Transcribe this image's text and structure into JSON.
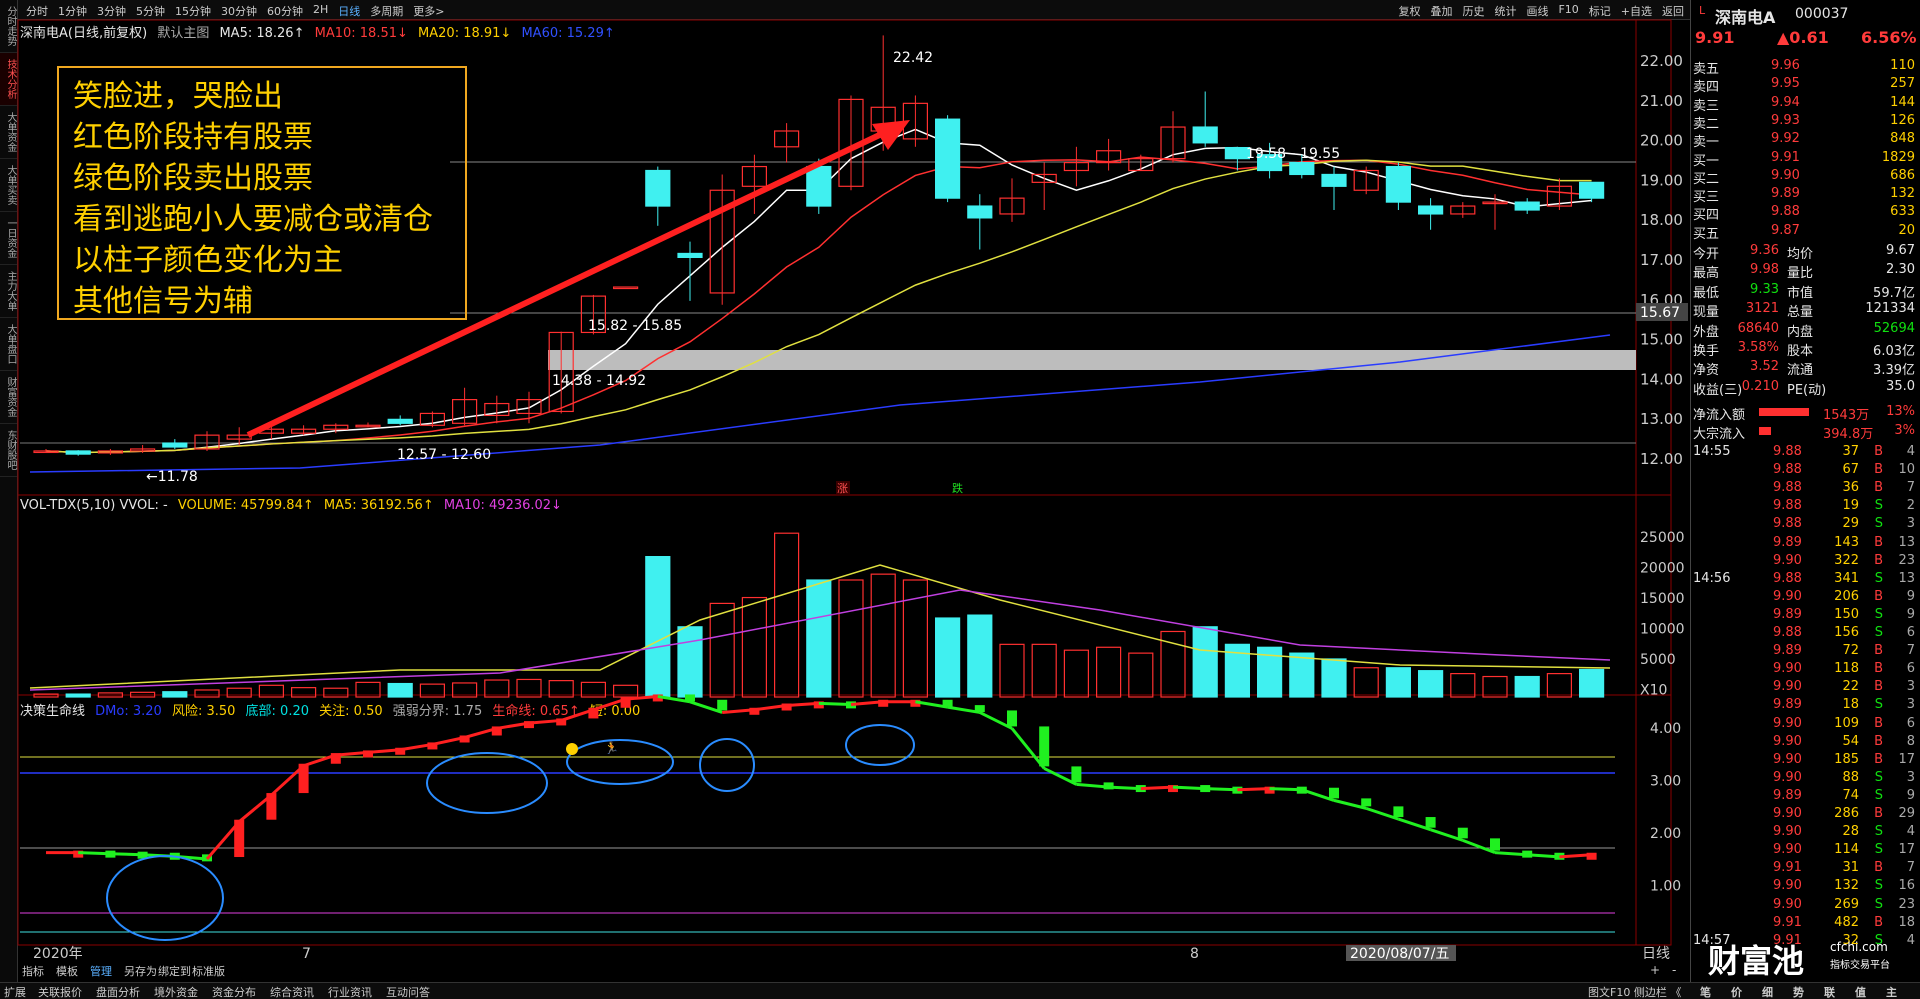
{
  "side_tabs": [
    "分时走势",
    "技术分析",
    "大单资金",
    "大单买卖",
    "一日资金",
    "主力大单",
    "大单盘口",
    "财富资金",
    "东财股吧"
  ],
  "periods": [
    "分时",
    "1分钟",
    "3分钟",
    "5分钟",
    "15分钟",
    "30分钟",
    "60分钟",
    "2H",
    "日线",
    "多周期",
    "更多>"
  ],
  "active_period": "日线",
  "tools": [
    "复权",
    "叠加",
    "历史",
    "统计",
    "画线",
    "F10",
    "标记",
    "+自选",
    "返回"
  ],
  "header": {
    "title": "深南电A(日线,前复权)",
    "main": "默认主图",
    "ma5": "MA5: 18.26↑",
    "ma10": "MA10: 18.51↓",
    "ma20": "MA20: 18.91↓",
    "ma60": "MA60: 15.29↑"
  },
  "vol_header": {
    "name": "VOL-TDX(5,10) VVOL: -",
    "volume": "VOLUME: 45799.84↑",
    "ma5": "MA5: 36192.56↑",
    "ma10": "MA10: 49236.02↓"
  },
  "ind_header": {
    "name": "决策生命线",
    "dmo": "DMo: 3.20",
    "risk": "风险: 3.50",
    "bottom": "底部: 0.20",
    "focus": "关注: 0.50",
    "divide": "强弱分界: 1.75",
    "life": "生命线: 0.65↑",
    "short": "短: 0.00"
  },
  "annotation": [
    "笑脸进，哭脸出",
    "红色阶段持有股票",
    "绿色阶段卖出股票",
    "看到逃跑小人要减仓或清仓",
    "以柱子颜色变化为主",
    "其他信号为辅"
  ],
  "price_labels": {
    "high": "22.42",
    "low": "←11.78",
    "r1": "19.58 - 19.55",
    "r2": "15.82 - 15.85",
    "r3": "14.38 - 14.92",
    "r4": "12.57 - 12.60",
    "current": "15.67",
    "up": "涨",
    "down": "跌"
  },
  "price_axis": [
    "22.00",
    "21.00",
    "20.00",
    "19.00",
    "18.00",
    "17.00",
    "16.00",
    "15.00",
    "14.00",
    "13.00",
    "12.00"
  ],
  "vol_axis": [
    "25000",
    "20000",
    "15000",
    "10000",
    "5000",
    "X10"
  ],
  "ind_axis": [
    "4.00",
    "3.00",
    "2.00",
    "1.00"
  ],
  "date_axis": {
    "year": "2020年",
    "m7": "7",
    "m8": "8",
    "cursor": "2020/08/07/五",
    "period": "日线",
    "plus": "+",
    "minus": "-"
  },
  "footer": [
    "指标",
    "模板",
    "管理",
    "另存为",
    "绑定到",
    "标准版"
  ],
  "bottom_tabs": [
    "扩展",
    "关联报价",
    "盘面分析",
    "境外资金",
    "资金分布",
    "综合资讯",
    "行业资讯",
    "互动问答"
  ],
  "bottom_right": "图文F10 侧边栏 《",
  "bottom_icons": [
    "笔",
    "价",
    "细",
    "势",
    "联",
    "值",
    "主"
  ],
  "quote": {
    "name": "深南电A",
    "code": "000037",
    "price": "9.91",
    "change": "▲0.61",
    "pct": "6.56%"
  },
  "asks": [
    [
      "卖五",
      "9.96",
      "110"
    ],
    [
      "卖四",
      "9.95",
      "257"
    ],
    [
      "卖三",
      "9.94",
      "144"
    ],
    [
      "卖二",
      "9.93",
      "126"
    ],
    [
      "卖一",
      "9.92",
      "848"
    ]
  ],
  "bids": [
    [
      "买一",
      "9.91",
      "1829"
    ],
    [
      "买二",
      "9.90",
      "686"
    ],
    [
      "买三",
      "9.89",
      "132"
    ],
    [
      "买四",
      "9.88",
      "633"
    ],
    [
      "买五",
      "9.87",
      "20"
    ]
  ],
  "stats": [
    [
      "今开",
      "9.36",
      "均价",
      "9.67"
    ],
    [
      "最高",
      "9.98",
      "量比",
      "2.30"
    ],
    [
      "最低",
      "9.33",
      "市值",
      "59.7亿"
    ],
    [
      "现量",
      "3121",
      "总量",
      "121334"
    ],
    [
      "外盘",
      "68640",
      "内盘",
      "52694"
    ],
    [
      "换手",
      "3.58%",
      "股本",
      "6.03亿"
    ],
    [
      "净资",
      "3.52",
      "流通",
      "3.39亿"
    ],
    [
      "收益(三)",
      "0.210",
      "PE(动)",
      "35.0"
    ]
  ],
  "flow": [
    [
      "净流入额",
      "1543万",
      "13%"
    ],
    [
      "大宗流入",
      "394.8万",
      "3%"
    ]
  ],
  "ticks": [
    [
      "14:55",
      "9.88",
      "37",
      "B",
      "4"
    ],
    [
      "",
      "9.88",
      "67",
      "B",
      "10"
    ],
    [
      "",
      "9.88",
      "36",
      "B",
      "7"
    ],
    [
      "",
      "9.88",
      "19",
      "S",
      "2"
    ],
    [
      "",
      "9.88",
      "29",
      "S",
      "3"
    ],
    [
      "",
      "9.89",
      "143",
      "B",
      "13"
    ],
    [
      "",
      "9.90",
      "322",
      "B",
      "23"
    ],
    [
      "14:56",
      "9.88",
      "341",
      "S",
      "13"
    ],
    [
      "",
      "9.90",
      "206",
      "B",
      "9"
    ],
    [
      "",
      "9.89",
      "150",
      "S",
      "9"
    ],
    [
      "",
      "9.88",
      "156",
      "S",
      "6"
    ],
    [
      "",
      "9.89",
      "72",
      "B",
      "7"
    ],
    [
      "",
      "9.90",
      "118",
      "B",
      "6"
    ],
    [
      "",
      "9.90",
      "22",
      "B",
      "3"
    ],
    [
      "",
      "9.89",
      "18",
      "S",
      "3"
    ],
    [
      "",
      "9.90",
      "109",
      "B",
      "6"
    ],
    [
      "",
      "9.90",
      "54",
      "B",
      "8"
    ],
    [
      "",
      "9.90",
      "185",
      "B",
      "17"
    ],
    [
      "",
      "9.90",
      "88",
      "S",
      "3"
    ],
    [
      "",
      "9.89",
      "74",
      "S",
      "9"
    ],
    [
      "",
      "9.90",
      "286",
      "B",
      "29"
    ],
    [
      "",
      "9.90",
      "28",
      "S",
      "4"
    ],
    [
      "",
      "9.90",
      "114",
      "S",
      "17"
    ],
    [
      "",
      "9.91",
      "31",
      "B",
      "7"
    ],
    [
      "",
      "9.90",
      "132",
      "S",
      "16"
    ],
    [
      "",
      "9.90",
      "269",
      "S",
      "23"
    ],
    [
      "",
      "9.91",
      "482",
      "B",
      "18"
    ],
    [
      "14:57",
      "9.91",
      "32",
      "S",
      "4"
    ]
  ],
  "logo": {
    "main": "财富池",
    "site": "cfchi.com",
    "sub": "指标交易平台"
  },
  "chart_data": {
    "type": "candlestick",
    "price_range": [
      11.5,
      22.5
    ],
    "candles": [
      [
        11.9,
        11.95,
        11.85,
        11.9
      ],
      [
        11.9,
        11.92,
        11.78,
        11.82
      ],
      [
        11.85,
        11.95,
        11.8,
        11.9
      ],
      [
        11.9,
        12.05,
        11.85,
        11.95
      ],
      [
        12.1,
        12.2,
        11.95,
        12.0
      ],
      [
        11.95,
        12.4,
        11.9,
        12.3
      ],
      [
        12.2,
        12.5,
        12.05,
        12.3
      ],
      [
        12.35,
        12.6,
        12.2,
        12.45
      ],
      [
        12.35,
        12.55,
        12.3,
        12.45
      ],
      [
        12.45,
        12.6,
        12.35,
        12.55
      ],
      [
        12.55,
        12.62,
        12.5,
        12.55
      ],
      [
        12.7,
        12.8,
        12.55,
        12.6
      ],
      [
        12.55,
        12.9,
        12.5,
        12.85
      ],
      [
        12.6,
        13.5,
        12.55,
        13.2
      ],
      [
        12.8,
        13.3,
        12.6,
        13.1
      ],
      [
        12.85,
        13.4,
        12.6,
        13.2
      ],
      [
        12.9,
        14.92,
        12.85,
        14.9
      ],
      [
        14.9,
        15.85,
        14.85,
        15.82
      ],
      [
        16.05,
        16.05,
        16.05,
        16.05
      ],
      [
        19.0,
        19.1,
        17.6,
        18.1
      ],
      [
        16.9,
        17.2,
        15.7,
        16.8
      ],
      [
        15.9,
        18.9,
        15.6,
        18.5
      ],
      [
        18.6,
        19.4,
        17.9,
        19.1
      ],
      [
        19.6,
        20.2,
        19.2,
        20.0
      ],
      [
        19.1,
        19.3,
        17.9,
        18.1
      ],
      [
        18.6,
        20.9,
        18.5,
        20.8
      ],
      [
        20.0,
        22.42,
        19.5,
        20.6
      ],
      [
        19.8,
        20.9,
        19.6,
        20.7
      ],
      [
        20.3,
        20.4,
        18.2,
        18.3
      ],
      [
        18.1,
        18.4,
        17.0,
        17.8
      ],
      [
        17.9,
        18.8,
        17.7,
        18.3
      ],
      [
        18.7,
        19.2,
        18.0,
        18.9
      ],
      [
        19.0,
        19.6,
        18.6,
        19.2
      ],
      [
        19.2,
        19.8,
        19.0,
        19.5
      ],
      [
        19.0,
        19.4,
        19.0,
        19.3
      ],
      [
        19.3,
        20.5,
        19.2,
        20.1
      ],
      [
        20.1,
        21.0,
        19.6,
        19.7
      ],
      [
        19.58,
        19.6,
        19.0,
        19.3
      ],
      [
        19.4,
        19.7,
        18.8,
        19.0
      ],
      [
        19.2,
        19.4,
        18.8,
        18.9
      ],
      [
        18.9,
        19.1,
        18.0,
        18.6
      ],
      [
        18.5,
        19.1,
        18.4,
        19.0
      ],
      [
        19.1,
        19.2,
        18.0,
        18.2
      ],
      [
        18.1,
        18.3,
        17.5,
        17.9
      ],
      [
        17.9,
        18.2,
        17.8,
        18.1
      ],
      [
        18.2,
        18.4,
        17.5,
        18.2
      ],
      [
        18.2,
        18.3,
        17.9,
        18.0
      ],
      [
        18.1,
        18.8,
        18.0,
        18.6
      ],
      [
        18.7,
        18.7,
        18.2,
        18.3
      ]
    ],
    "volume": [
      500,
      500,
      700,
      800,
      900,
      1200,
      1500,
      2000,
      1600,
      1500,
      2500,
      2300,
      2200,
      2400,
      2900,
      3000,
      2800,
      2500,
      2000,
      24000,
      12000,
      16000,
      17000,
      28000,
      20000,
      20000,
      21000,
      20000,
      13500,
      14000,
      9000,
      9000,
      8000,
      8500,
      7500,
      11200,
      12000,
      9000,
      8500,
      7500,
      6500,
      5000,
      5000,
      4500,
      4000,
      3500,
      3500,
      4000,
      4700
    ],
    "indicator": [
      0.72,
      0.72,
      0.7,
      0.68,
      0.65,
      0.6,
      1.3,
      1.8,
      2.35,
      2.55,
      2.6,
      2.65,
      2.75,
      2.88,
      3.05,
      3.15,
      3.2,
      3.4,
      3.6,
      3.65,
      3.55,
      3.35,
      3.4,
      3.48,
      3.52,
      3.5,
      3.55,
      3.55,
      3.45,
      3.35,
      3.05,
      2.3,
      2.0,
      1.95,
      1.92,
      1.95,
      1.92,
      1.9,
      1.92,
      1.9,
      1.7,
      1.55,
      1.35,
      1.15,
      0.95,
      0.72,
      0.68,
      0.64,
      0.68
    ],
    "series": [
      {
        "name": "MA5",
        "color": "#ffffff"
      },
      {
        "name": "MA10",
        "color": "#ff3030"
      },
      {
        "name": "MA20",
        "color": "#e0e040"
      },
      {
        "name": "MA60",
        "color": "#2a3cff"
      }
    ]
  }
}
